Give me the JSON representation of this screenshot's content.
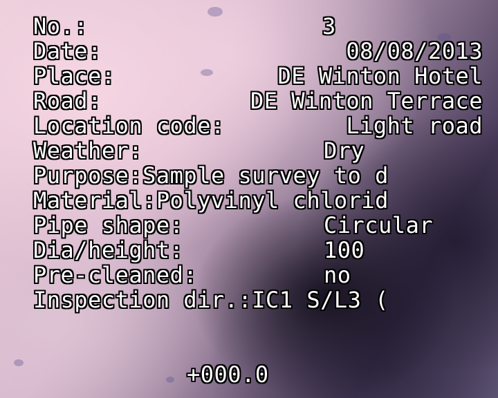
{
  "osd": {
    "no_label": "No.:",
    "no_value": "3",
    "date_label": "Date:",
    "date_value": "08/08/2013",
    "place_label": "Place:",
    "place_value": "DE Winton Hotel",
    "road_label": "Road:",
    "road_value": "DE Winton Terrace",
    "location_label": "Location code:",
    "location_value": "Light road",
    "weather_label": "Weather:",
    "weather_value": "Dry",
    "purpose_line": "Purpose:Sample survey to d",
    "material_line": "Material:Polyvinyl chlorid",
    "pipe_shape_label": "Pipe shape:",
    "pipe_shape_value": "Circular",
    "dia_label": "Dia/height:",
    "dia_value": "100",
    "precleaned_label": "Pre-cleaned:",
    "precleaned_value": "no",
    "inspection_line": "Inspection dir.:IC1 S/L3 (",
    "counter": "+000.0"
  }
}
